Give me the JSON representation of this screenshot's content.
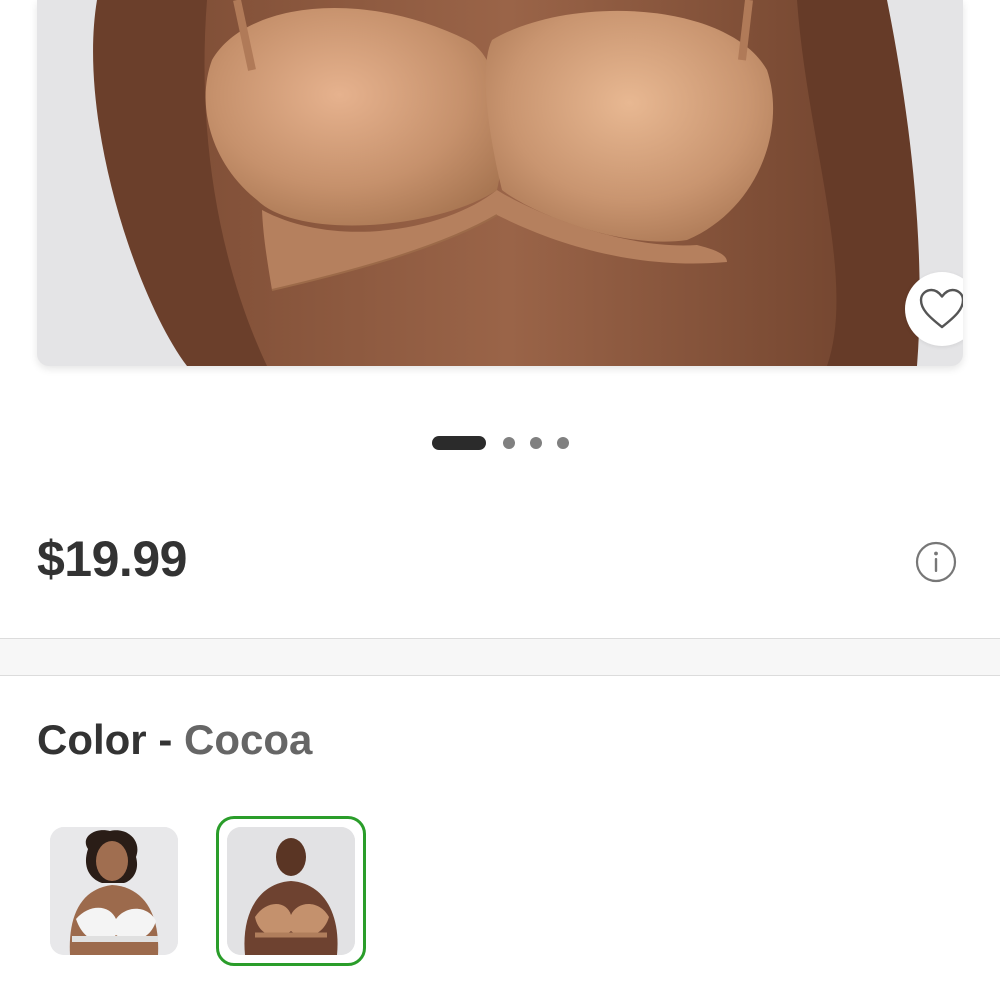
{
  "product": {
    "price": "$19.99",
    "image_count": 4,
    "active_image": 1
  },
  "color": {
    "label": "Color",
    "separator": "-",
    "selected": "Cocoa",
    "swatches": [
      {
        "name": "white",
        "selected": false
      },
      {
        "name": "cocoa",
        "selected": true
      }
    ]
  },
  "icons": {
    "favorite": "heart-outline-icon",
    "info": "info-circle-icon"
  },
  "colors": {
    "selected_border": "#2a9d2a",
    "pager_active": "#2b2b2b",
    "pager_inactive": "#808080"
  }
}
